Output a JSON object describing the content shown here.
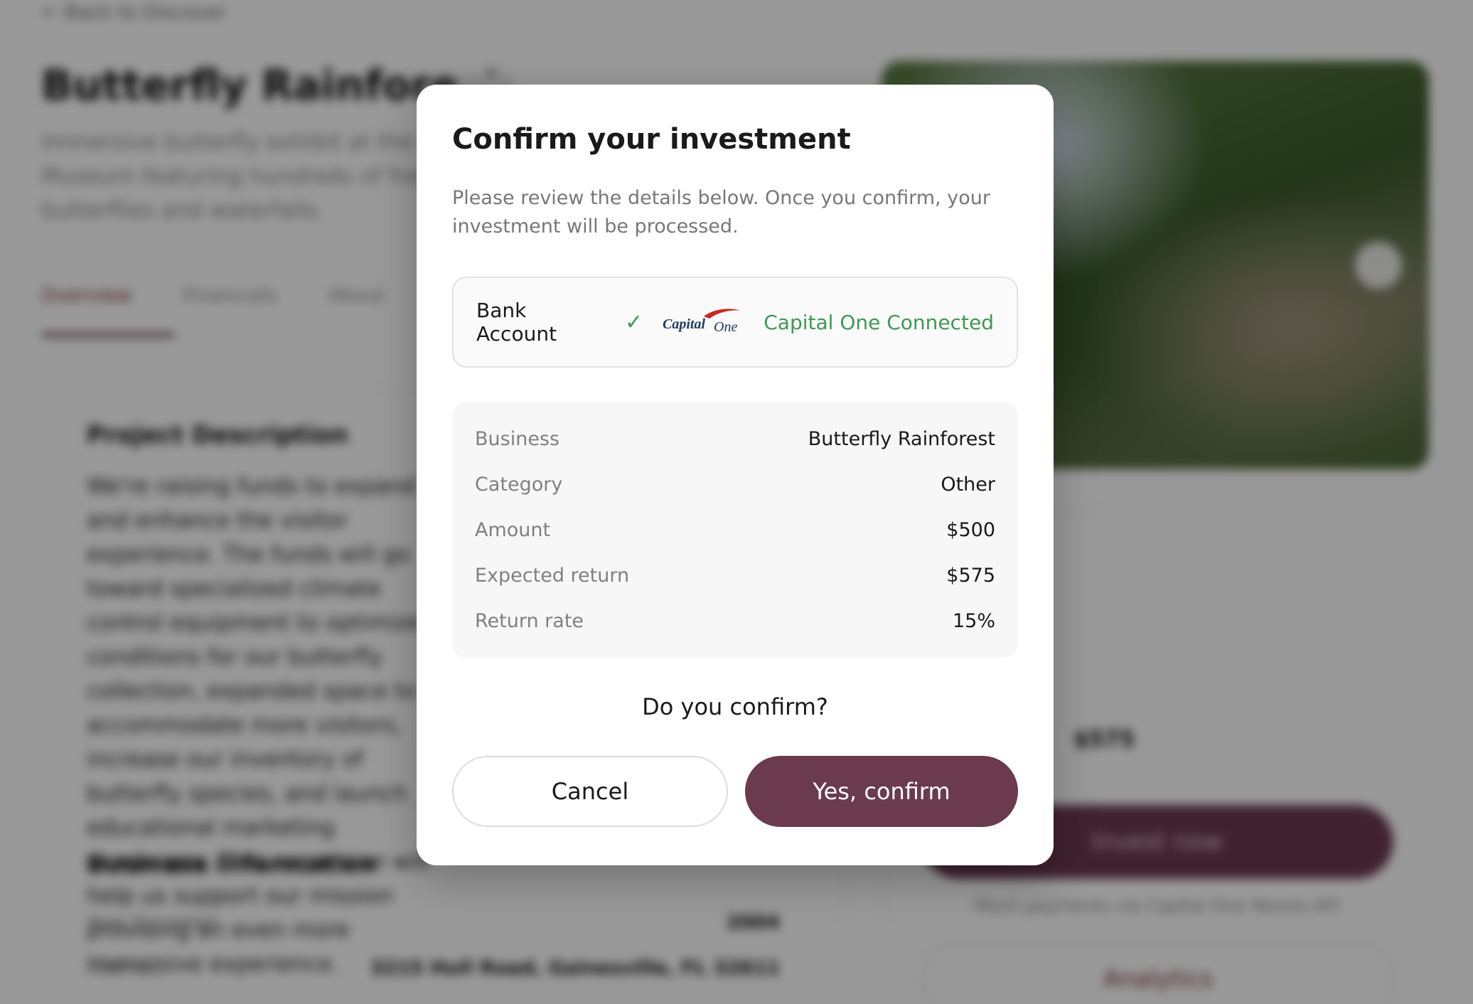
{
  "background": {
    "back_link": "← Back to Discover",
    "title": "Butterfly Rainforest",
    "description": "Immersive butterfly exhibit at the Florida Museum featuring hundreds of free-flying butterflies and waterfalls.",
    "tabs": [
      {
        "label": "Overview"
      },
      {
        "label": "Financials"
      },
      {
        "label": "About"
      }
    ],
    "project_title": "Project Description",
    "project_text": "We're raising funds to expand and enhance the visitor experience. The funds will go toward specialized climate control equipment to optimize conditions for our butterfly collection, expanded space to accommodate more visitors, increase our inventory of butterfly species, and launch educational marketing campaigns. This expansion will help us support our mission providing an even more immersive experience.",
    "business_title": "Business Information",
    "business_rows": [
      {
        "key": "Year Founded",
        "value": "2004"
      },
      {
        "key": "Address",
        "value": "3215 Hull Road, Gainesville, FL 32611"
      }
    ],
    "side_amount": "$575",
    "invest_button": "Invest now",
    "payments_note": "Mock payments via Capital One Nessie API",
    "analytics_button": "Analytics"
  },
  "modal": {
    "title": "Confirm your investment",
    "subtitle": "Please review the details below. Once you confirm, your investment will be processed.",
    "bank": {
      "label": "Bank Account",
      "check": "✓",
      "logo_text": "Capital",
      "logo_script": "One",
      "status": "Capital One Connected"
    },
    "details": [
      {
        "key": "Business",
        "value": "Butterfly Rainforest"
      },
      {
        "key": "Category",
        "value": "Other"
      },
      {
        "key": "Amount",
        "value": "$500"
      },
      {
        "key": "Expected return",
        "value": "$575"
      },
      {
        "key": "Return rate",
        "value": "15%"
      }
    ],
    "question": "Do you confirm?",
    "cancel_label": "Cancel",
    "confirm_label": "Yes, confirm"
  },
  "colors": {
    "accent": "#6b3a4e",
    "success": "#3e9a52",
    "capital_one_blue": "#1f3a5f",
    "capital_one_red": "#c8281e"
  }
}
